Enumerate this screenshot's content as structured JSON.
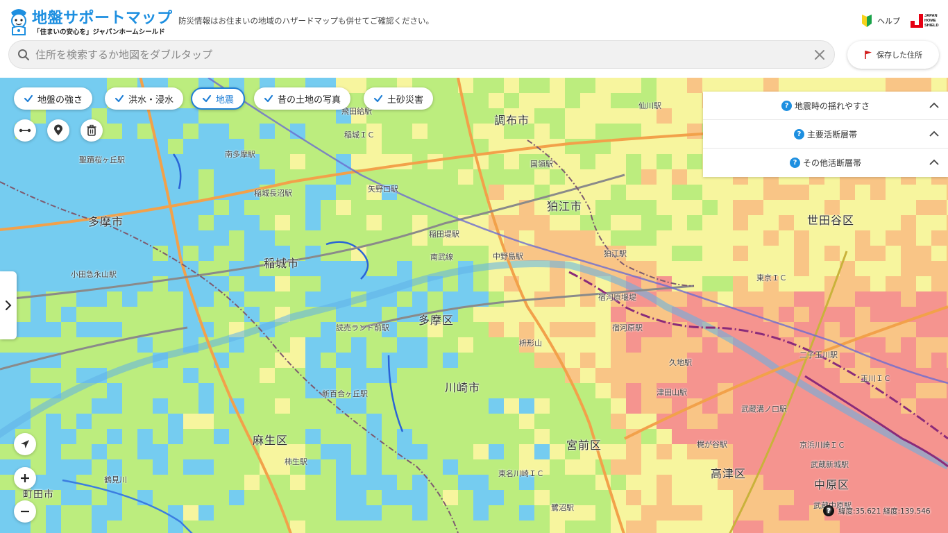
{
  "header": {
    "logo_title": "地盤サポートマップ",
    "logo_subtitle": "「住まいの安心を」ジャパンホームシールド",
    "notice": "防災情報はお住まいの地域のハザードマップも併せてご確認ください。",
    "help_label": "ヘルプ",
    "brand_logo_text": "JAPAN HOME SHIELD"
  },
  "search": {
    "placeholder": "住所を検索するか地図をダブルタップ",
    "value": ""
  },
  "saved_button": {
    "label": "保存した住所"
  },
  "layer_chips": [
    {
      "label": "地盤の強さ",
      "active": false
    },
    {
      "label": "洪水・浸水",
      "active": false
    },
    {
      "label": "地震",
      "active": true
    },
    {
      "label": "昔の土地の写真",
      "active": false
    },
    {
      "label": "土砂災害",
      "active": false
    }
  ],
  "legend_panel": {
    "rows": [
      {
        "label": "地震時の揺れやすさ"
      },
      {
        "label": "主要活断層帯"
      },
      {
        "label": "その他活断層帯"
      }
    ]
  },
  "coordinates": {
    "text": "緯度:35.621 経度:139.546"
  },
  "map_labels": {
    "chofu": "調布市",
    "komae": "狛江市",
    "setagaya": "世田谷区",
    "tama": "多摩市",
    "inagi": "稲城市",
    "tama_ku": "多摩区",
    "kawasaki": "川崎市",
    "asao": "麻生区",
    "miyamae": "宮前区",
    "takatsu": "高津区",
    "nakahara": "中原区",
    "machida": "町田市",
    "st_tobitakyu": "飛田給駅",
    "st_inaginagano": "稲城長沼駅",
    "st_yanokuchi": "矢野口駅",
    "st_inadazutsumi": "稲田堤駅",
    "st_nakanoshima": "中野島駅",
    "st_komae": "狛江駅",
    "st_shukugawara": "宿河原駅",
    "st_kujicho": "久地駅",
    "st_tsudayama": "津田山駅",
    "st_futakotamagawa": "二子玉川駅",
    "st_musashimizonokuchi": "武蔵溝ノ口駅",
    "st_kajigaya": "梶が谷駅",
    "st_shinyurigaoka": "新百合ヶ丘駅",
    "st_yomiuriland": "読売ランド前駅",
    "st_kakio": "柿生駅",
    "st_odakyunagayama": "小田急永山駅",
    "st_seisekisakuragaoka": "聖蹟桜ヶ丘駅",
    "st_minamitama": "南多摩駅",
    "st_kokuryo": "国領駅",
    "st_musashishinjo": "武蔵新城駅",
    "st_saginuma": "鷺沼駅",
    "st_musashinakahara": "武蔵中原駅",
    "st_sengawa": "仙川駅",
    "ic_inagi": "稲城ＩＣ",
    "ic_tokyo": "東京ＩＣ",
    "ic_tomei_kawasaki": "東名川崎ＩＣ",
    "ic_keihin_kawasaki": "京浜川崎ＩＣ",
    "ic_tamagawa": "玉川ＩＣ",
    "masugatayama": "枡形山",
    "shukugawara_weir": "宿河原堰堤",
    "tsurumigawa": "鶴見川",
    "nambu_line": "南武線"
  },
  "colors": {
    "accent": "#1f7fd6",
    "logo_blue": "#1d8fe0",
    "hazard_low": "#67c8f5",
    "hazard_mid_low": "#b6ec77",
    "hazard_mid": "#f7f59a",
    "hazard_mid_high": "#f9c07f",
    "hazard_high": "#f58a8a"
  }
}
